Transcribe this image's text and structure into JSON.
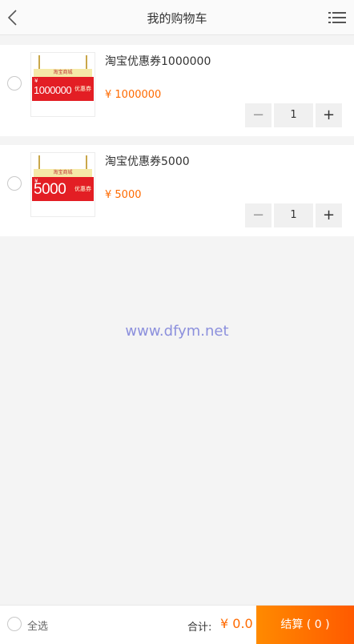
{
  "header": {
    "title": "我的购物车",
    "back_icon": "chevron-left-icon",
    "menu_icon": "list-menu-icon"
  },
  "items": [
    {
      "name": "淘宝优惠券1000000",
      "price": "¥ 1000000",
      "qty": "1",
      "coupon": {
        "top_text": "淘宝商城",
        "yen": "¥",
        "amount": "1000000",
        "tag": "优惠券"
      },
      "minus": "−",
      "plus": "+"
    },
    {
      "name": "淘宝优惠券5000",
      "price": "¥ 5000",
      "qty": "1",
      "coupon": {
        "top_text": "淘宝商城",
        "yen": "¥",
        "amount": "5000",
        "tag": "优惠券"
      },
      "minus": "−",
      "plus": "+"
    }
  ],
  "watermark": "www.dfym.net",
  "footer": {
    "select_all": "全选",
    "total_label": "合计:",
    "total_value": "¥ 0.0",
    "checkout": "结算 ( 0 )"
  },
  "colors": {
    "accent": "#ff6a00",
    "coupon_red": "#e31e24",
    "background": "#f4f4f4"
  }
}
